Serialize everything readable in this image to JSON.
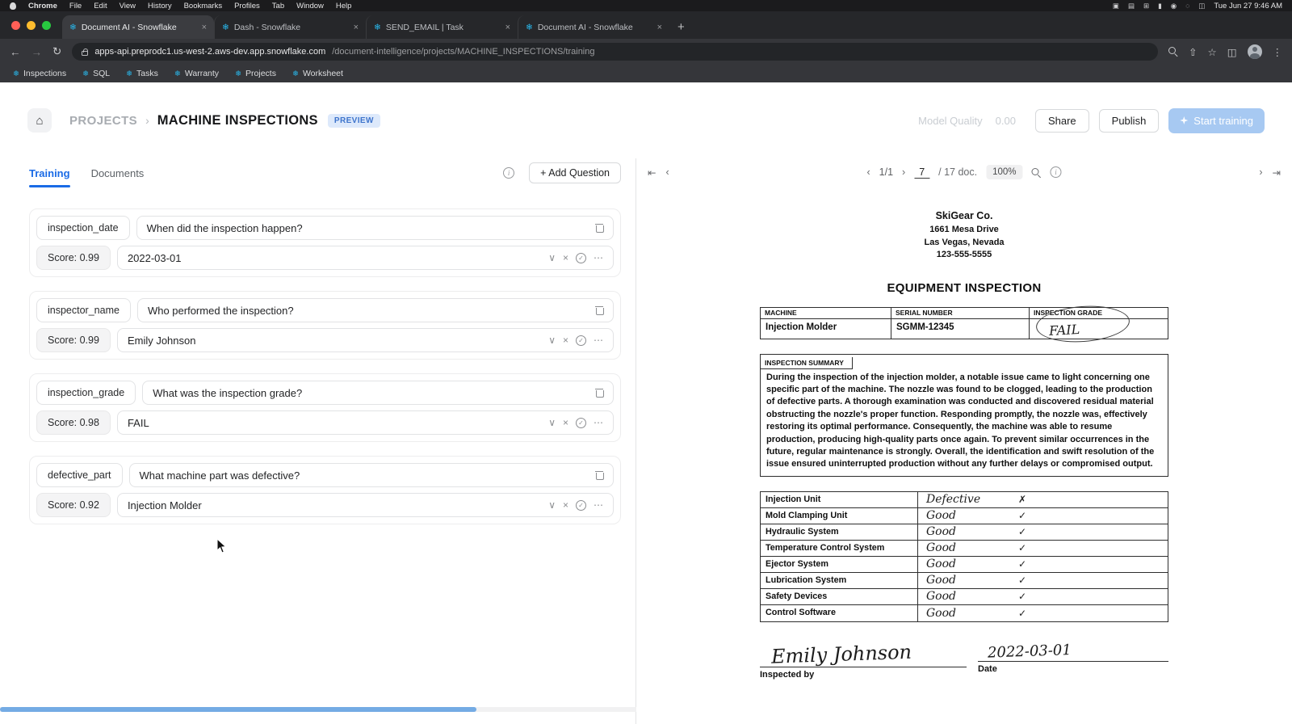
{
  "icons": {
    "snowflake": "❄",
    "back": "←",
    "forward": "→",
    "reload": "↻",
    "share": "⇧",
    "star": "☆",
    "split": "◫",
    "more": "⋮",
    "close": "×",
    "new_tab": "+",
    "home": "⌂",
    "chevron_down": "∨",
    "cross": "×",
    "check": "✓",
    "ellipsis": "⋯",
    "first": "⇤",
    "prev": "‹",
    "next": "›",
    "last": "⇥",
    "info": "i"
  },
  "menubar": {
    "items": [
      "Chrome",
      "File",
      "Edit",
      "View",
      "History",
      "Bookmarks",
      "Profiles",
      "Tab",
      "Window",
      "Help"
    ],
    "clock": "Tue Jun 27 9:46 AM"
  },
  "browser": {
    "tabs": [
      {
        "label": "Document AI - Snowflake"
      },
      {
        "label": "Dash - Snowflake"
      },
      {
        "label": "SEND_EMAIL | Task"
      },
      {
        "label": "Document AI - Snowflake"
      }
    ],
    "url_host": "apps-api.preprodc1.us-west-2.aws-dev.app.snowflake.com",
    "url_path": "/document-intelligence/projects/MACHINE_INSPECTIONS/training",
    "bookmarks": [
      "Inspections",
      "SQL",
      "Tasks",
      "Warranty",
      "Projects",
      "Worksheet"
    ]
  },
  "header": {
    "breadcrumb": "PROJECTS",
    "separator": "›",
    "title": "MACHINE INSPECTIONS",
    "badge": "PREVIEW",
    "model_quality_label": "Model Quality",
    "model_quality_value": "0.00",
    "share_label": "Share",
    "publish_label": "Publish",
    "start_training_label": "Start training"
  },
  "panel": {
    "tab_training": "Training",
    "tab_documents": "Documents",
    "add_question_label": "+ Add Question",
    "questions": [
      {
        "field": "inspection_date",
        "question": "When did the inspection happen?",
        "score": "Score: 0.99",
        "answer": "2022-03-01"
      },
      {
        "field": "inspector_name",
        "question": "Who performed the inspection?",
        "score": "Score: 0.99",
        "answer": "Emily Johnson"
      },
      {
        "field": "inspection_grade",
        "question": "What was the inspection grade?",
        "score": "Score: 0.98",
        "answer": "FAIL"
      },
      {
        "field": "defective_part",
        "question": "What machine part was defective?",
        "score": "Score: 0.92",
        "answer": "Injection Molder"
      }
    ]
  },
  "viewer": {
    "page_indicator": "1/1",
    "doc_current": "7",
    "doc_total": "/ 17 doc.",
    "zoom": "100%"
  },
  "document": {
    "company": "SkiGear Co.",
    "address_line1": "1661 Mesa Drive",
    "address_line2": "Las Vegas, Nevada",
    "phone": "123-555-5555",
    "title": "EQUIPMENT INSPECTION",
    "machine_header": "MACHINE",
    "serial_header": "SERIAL NUMBER",
    "grade_header": "INSPECTION GRADE",
    "machine_value": "Injection Molder",
    "serial_value": "SGMM-12345",
    "grade_value": "FAIL",
    "summary_label": "INSPECTION SUMMARY",
    "summary_text": "During the inspection of the injection molder, a notable issue came to light concerning one specific part of the machine. The nozzle was found to be clogged, leading to the production of defective parts. A thorough examination was conducted and discovered residual material obstructing the nozzle's proper function. Responding promptly, the nozzle was, effectively restoring its optimal performance. Consequently, the machine was able to resume production, producing high-quality parts once again. To prevent similar occurrences in the future, regular maintenance is strongly. Overall, the identification and swift resolution of the issue ensured uninterrupted production without any further delays or compromised output.",
    "parts": [
      {
        "name": "Injection Unit",
        "status": "Defective",
        "mark": "✗"
      },
      {
        "name": "Mold Clamping Unit",
        "status": "Good",
        "mark": "✓"
      },
      {
        "name": "Hydraulic System",
        "status": "Good",
        "mark": "✓"
      },
      {
        "name": "Temperature Control System",
        "status": "Good",
        "mark": "✓"
      },
      {
        "name": "Ejector System",
        "status": "Good",
        "mark": "✓"
      },
      {
        "name": "Lubrication System",
        "status": "Good",
        "mark": "✓"
      },
      {
        "name": "Safety Devices",
        "status": "Good",
        "mark": "✓"
      },
      {
        "name": "Control Software",
        "status": "Good",
        "mark": "✓"
      }
    ],
    "signature": "Emily Johnson",
    "inspected_by_label": "Inspected by",
    "date_value": "2022-03-01",
    "date_label": "Date"
  }
}
